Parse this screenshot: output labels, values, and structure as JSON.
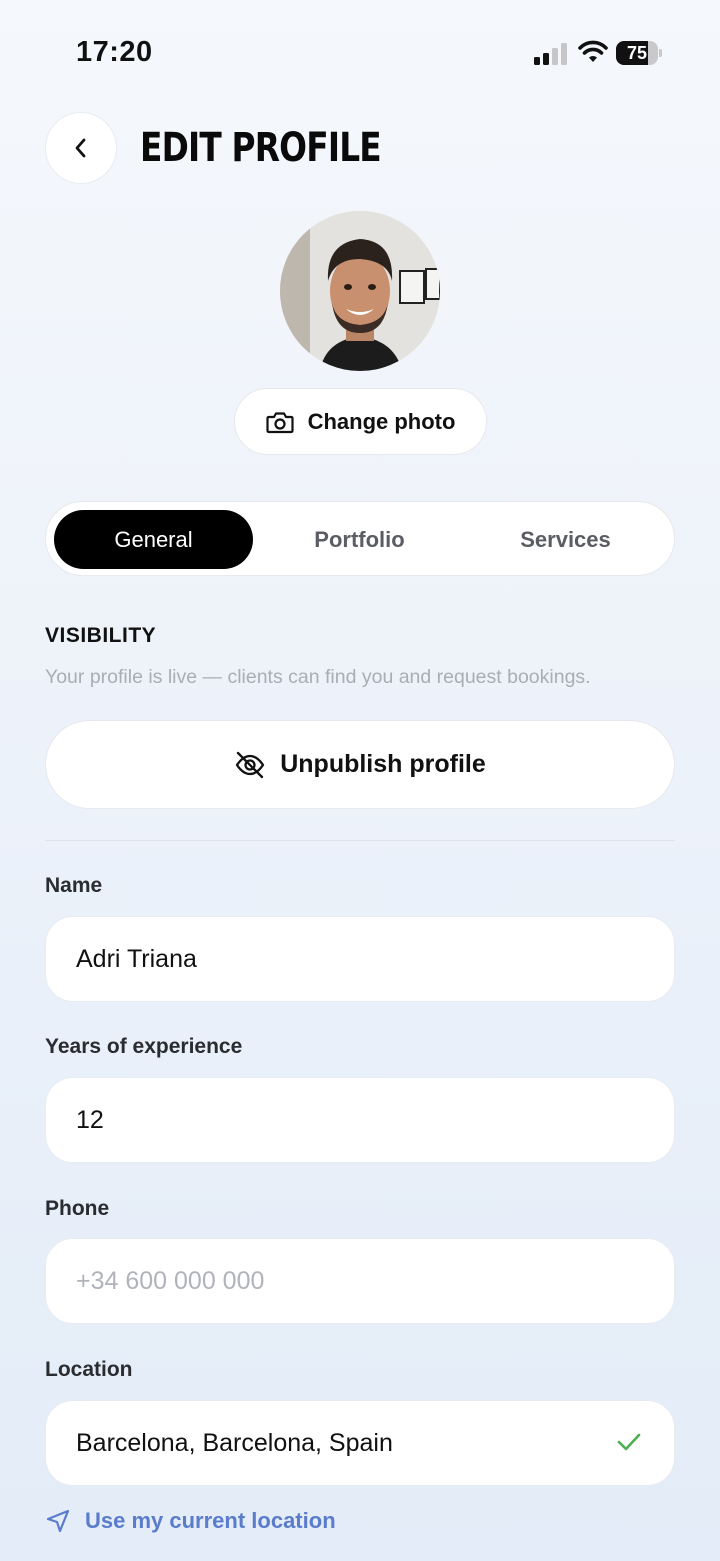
{
  "status_bar": {
    "time": "17:20",
    "battery_level": "75",
    "battery_fraction": 0.75
  },
  "header": {
    "title": "EDIT PROFILE"
  },
  "profile": {
    "change_photo_label": "Change photo"
  },
  "tabs": [
    {
      "label": "General",
      "active": true
    },
    {
      "label": "Portfolio",
      "active": false
    },
    {
      "label": "Services",
      "active": false
    }
  ],
  "visibility": {
    "heading": "VISIBILITY",
    "description": "Your profile is live — clients can find you and request bookings.",
    "unpublish_label": "Unpublish profile"
  },
  "form": {
    "name": {
      "label": "Name",
      "value": "Adri Triana",
      "placeholder": ""
    },
    "experience": {
      "label": "Years of experience",
      "value": "12",
      "placeholder": ""
    },
    "phone": {
      "label": "Phone",
      "value": "",
      "placeholder": "+34 600 000 000"
    },
    "location": {
      "label": "Location",
      "value": "Barcelona, Barcelona, Spain",
      "placeholder": ""
    },
    "use_location_label": "Use my current location"
  },
  "colors": {
    "accent_link": "#5a7ccb",
    "check_green": "#4caf50",
    "active_tab": "#000000"
  }
}
